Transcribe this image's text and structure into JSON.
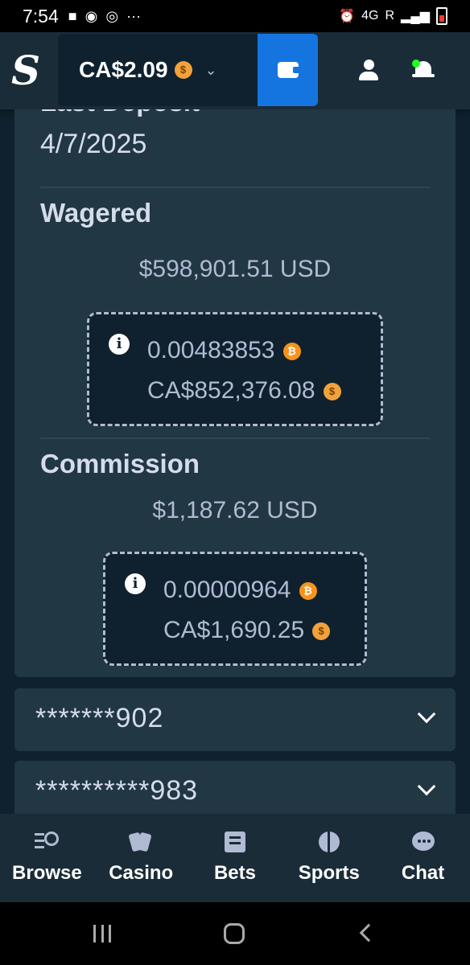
{
  "status_bar": {
    "time": "7:54",
    "network": "4G",
    "signal_label": "R"
  },
  "header": {
    "logo": "S",
    "balance": "CA$2.09",
    "currency_icon": "cad-coin-icon"
  },
  "stats": {
    "last_deposit_label": "Last Deposit",
    "last_deposit_value": "4/7/2025",
    "wagered_label": "Wagered",
    "wagered_usd": "$598,901.51 USD",
    "wagered_btc": "0.00483853",
    "wagered_cad": "CA$852,376.08",
    "commission_label": "Commission",
    "commission_usd": "$1,187.62 USD",
    "commission_btc": "0.00000964",
    "commission_cad": "CA$1,690.25"
  },
  "accounts": [
    {
      "masked": "*******902"
    },
    {
      "masked": "**********983"
    }
  ],
  "bottom_nav": [
    {
      "label": "Browse"
    },
    {
      "label": "Casino"
    },
    {
      "label": "Bets"
    },
    {
      "label": "Sports"
    },
    {
      "label": "Chat"
    }
  ],
  "colors": {
    "background": "#0f212e",
    "card": "#213743",
    "header": "#1a2c38",
    "accent_blue": "#1475e1",
    "btc": "#f7931a",
    "cad_coin": "#f0a23b",
    "online_dot": "#1fff20"
  }
}
